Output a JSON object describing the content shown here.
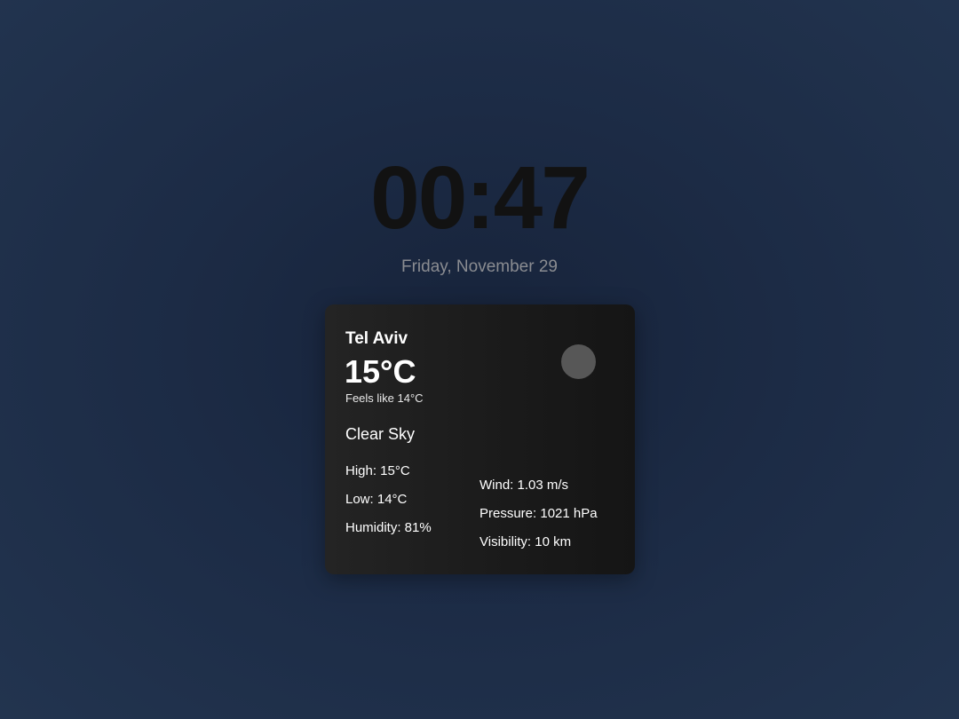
{
  "clock": {
    "time": "00:47",
    "date": "Friday, November 29"
  },
  "weather": {
    "city": "Tel Aviv",
    "temperature": "15°C",
    "feels_like": "Feels like 14°C",
    "condition": "Clear Sky",
    "icon": "clear-sky-icon",
    "details_left": [
      "High: 15°C",
      "Low: 14°C",
      "Humidity: 81%"
    ],
    "details_right": [
      "Wind: 1.03 m/s",
      "Pressure: 1021 hPa",
      "Visibility: 10 km"
    ]
  },
  "colors": {
    "background": "#1c2b45",
    "card": "#1e1e1e",
    "clock_text": "#121212",
    "date_text": "#8a8c91",
    "card_text": "#ffffff",
    "icon": "#575757"
  }
}
